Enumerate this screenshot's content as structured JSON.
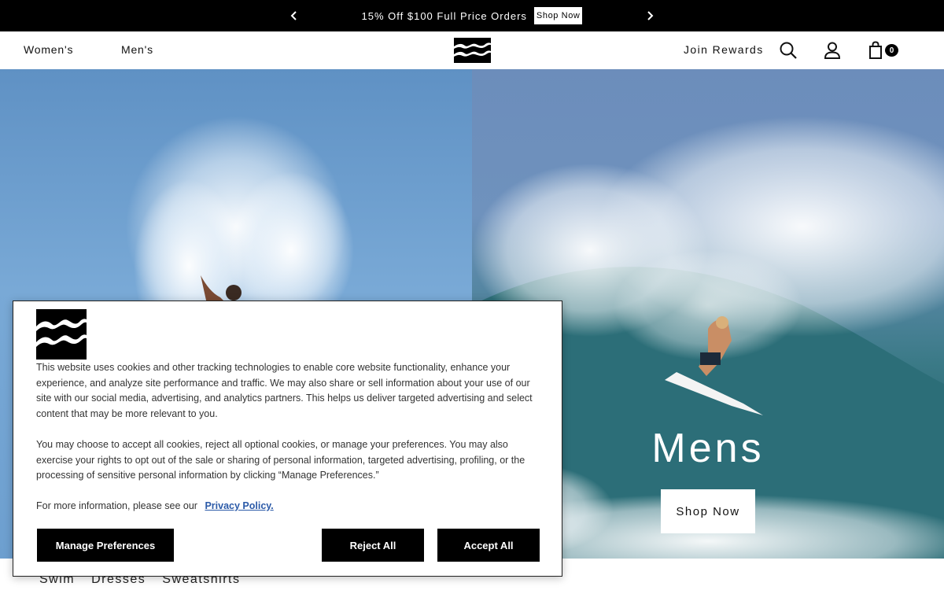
{
  "promo": {
    "text": "15% Off $100 Full Price Orders",
    "cta": "Shop Now",
    "prev_icon": "chevron-left-icon",
    "next_icon": "chevron-right-icon"
  },
  "header": {
    "nav": [
      "Women's",
      "Men's"
    ],
    "logo_icon": "billabong-wave-logo",
    "join_rewards": "Join Rewards",
    "search_icon": "search-icon",
    "account_icon": "user-icon",
    "cart_icon": "shopping-bag-icon",
    "cart_count": "0"
  },
  "hero": {
    "right_title": "Mens",
    "right_cta": "Shop Now"
  },
  "categories": [
    "Swim",
    "Dresses",
    "Sweatshirts"
  ],
  "cookie_banner": {
    "logo_icon": "billabong-wave-logo",
    "paragraph1": "This website uses cookies and other tracking technologies to enable core website functionality, enhance your experience, and analyze site performance and traffic. We may also share or sell information about your use of our site with our social media, advertising, and analytics partners. This helps us deliver targeted advertising and select content that may be more relevant to you.",
    "paragraph2": "You may choose to accept all cookies, reject all optional cookies, or manage your preferences. You may also exercise your rights to opt out of the sale or sharing of personal information, targeted advertising, profiling, or the processing of sensitive personal information by clicking “Manage Preferences.”",
    "paragraph3_prefix": "For more information, please see our",
    "privacy_link": "Privacy Policy.",
    "manage_button": "Manage Preferences",
    "reject_button": "Reject All",
    "accept_button": "Accept All"
  },
  "colors": {
    "promo_bar": "#000000",
    "button_dark": "#000000",
    "link": "#2b5aa8"
  }
}
